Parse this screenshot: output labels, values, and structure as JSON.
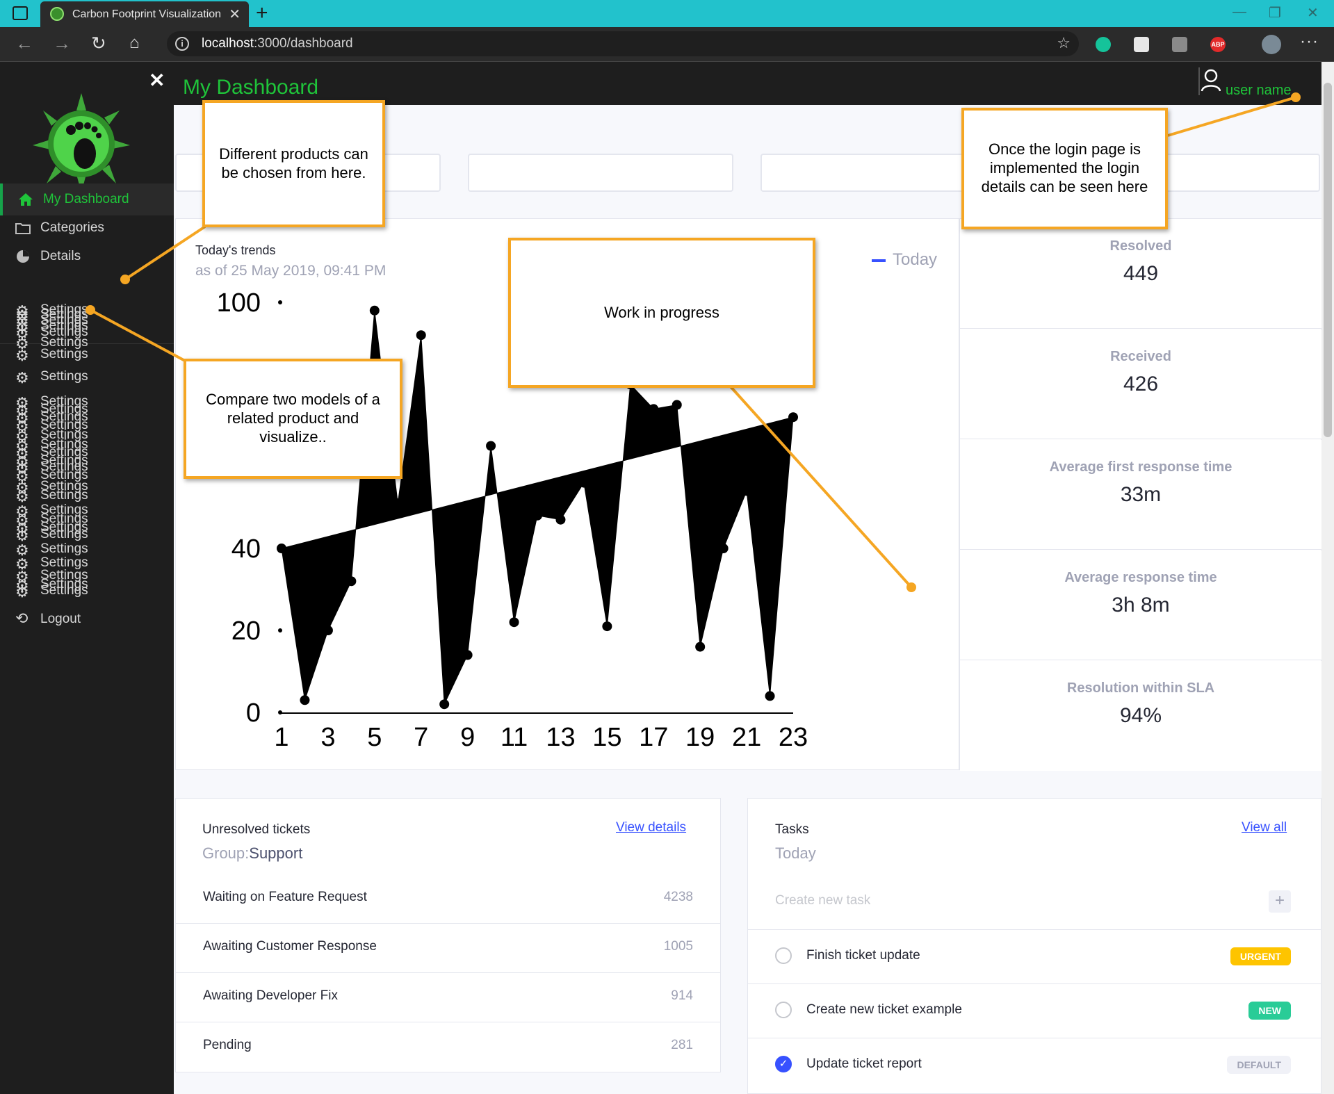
{
  "browser": {
    "tab_title": "Carbon Footprint Visualization",
    "url_host": "localhost",
    "url_path": ":3000/dashboard",
    "ext_abp": "ABP"
  },
  "sidebar": {
    "items": [
      {
        "label": "My Dashboard",
        "icon": "home-icon",
        "active": true
      },
      {
        "label": "Categories",
        "icon": "folder-icon",
        "active": false
      },
      {
        "label": "Details",
        "icon": "pie-chart-icon",
        "active": false
      }
    ],
    "settings_label": "Settings",
    "logout_label": "Logout"
  },
  "header": {
    "title": "My Dashboard",
    "user_name": "user name"
  },
  "trends": {
    "title": "Today's trends",
    "subtitle": "as of 25 May 2019, 09:41 PM",
    "legend": "Today"
  },
  "chart_data": {
    "type": "area",
    "title": "Today's trends",
    "x": [
      1,
      2,
      3,
      4,
      5,
      6,
      7,
      8,
      9,
      10,
      11,
      12,
      13,
      14,
      15,
      16,
      17,
      18,
      19,
      20,
      21,
      22,
      23
    ],
    "series": [
      {
        "name": "Today",
        "values": [
          40,
          3,
          20,
          32,
          98,
          51,
          92,
          2,
          14,
          65,
          22,
          48,
          47,
          56,
          21,
          80,
          74,
          75,
          16,
          40,
          54,
          4,
          72
        ]
      }
    ],
    "x_ticks": [
      "1",
      "3",
      "5",
      "7",
      "9",
      "11",
      "13",
      "15",
      "17",
      "19",
      "21",
      "23"
    ],
    "y_ticks": [
      "0",
      "20",
      "40",
      "100"
    ],
    "ylim": [
      0,
      100
    ],
    "legend_position": "top-right",
    "color": "#000000"
  },
  "stats": [
    {
      "label": "Resolved",
      "value": "449"
    },
    {
      "label": "Received",
      "value": "426"
    },
    {
      "label": "Average first response time",
      "value": "33m"
    },
    {
      "label": "Average response time",
      "value": "3h 8m"
    },
    {
      "label": "Resolution within SLA",
      "value": "94%"
    }
  ],
  "tickets": {
    "title": "Unresolved tickets",
    "group_label": "Group:",
    "group_value": "Support",
    "link": "View details",
    "rows": [
      {
        "label": "Waiting on Feature Request",
        "value": "4238"
      },
      {
        "label": "Awaiting Customer Response",
        "value": "1005"
      },
      {
        "label": "Awaiting Developer Fix",
        "value": "914"
      },
      {
        "label": "Pending",
        "value": "281"
      }
    ]
  },
  "tasks": {
    "title": "Tasks",
    "subtitle": "Today",
    "link": "View all",
    "new_task_placeholder": "Create new task",
    "items": [
      {
        "label": "Finish ticket update",
        "badge": "URGENT",
        "badge_color": "#fec400",
        "checked": false
      },
      {
        "label": "Create new ticket example",
        "badge": "NEW",
        "badge_color": "#29cc97",
        "checked": false
      },
      {
        "label": "Update ticket report",
        "badge": "DEFAULT",
        "badge_color": "#f0f1f7",
        "checked": true
      }
    ]
  },
  "annotations": {
    "products": "Different products can be chosen from here.",
    "login": "Once the login page is implemented the login details can be seen here",
    "wip": "Work in progress",
    "compare": "Compare two models of a related product and visualize.."
  },
  "colors": {
    "accent": "#1fc43a",
    "annotation": "#f5a623",
    "link": "#3751ff"
  }
}
